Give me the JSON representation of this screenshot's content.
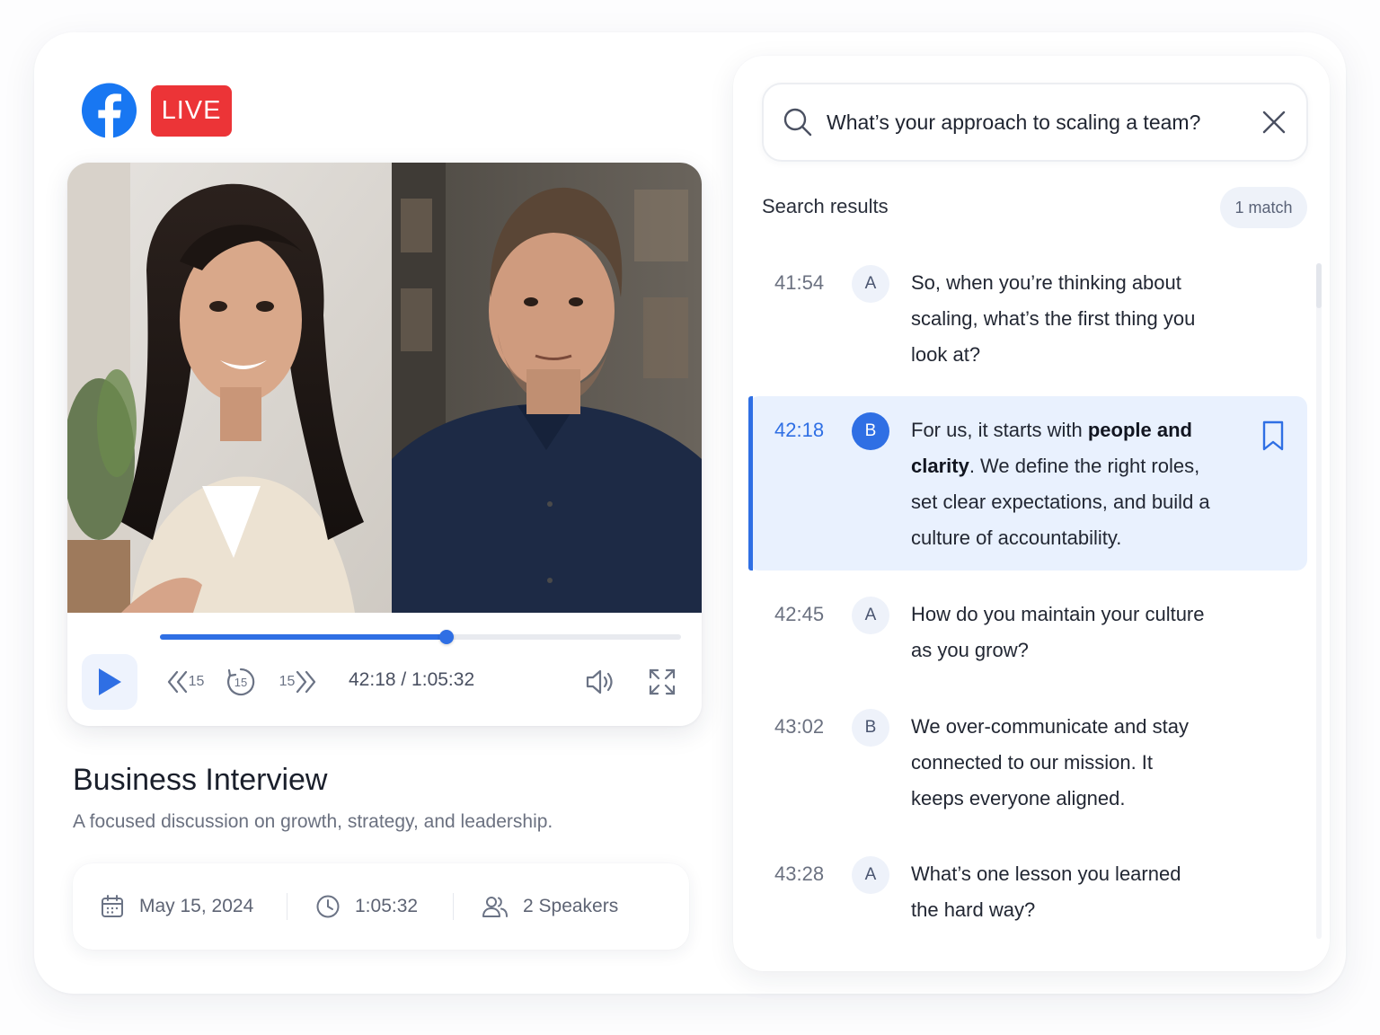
{
  "brand": {
    "logo_icon": "facebook-icon",
    "live_label": "LIVE",
    "brand_color": "#1877f2",
    "live_color": "#ec3437"
  },
  "player": {
    "progress_fraction": 0.55,
    "time_readout": "42:18 / 1:05:32",
    "rewind_label": "15",
    "replay_label": "15",
    "forward_label": "15",
    "accent": "#2f6fe4"
  },
  "episode": {
    "title": "Business Interview",
    "subtitle": "A focused discussion on growth, strategy, and leadership.",
    "date": "May 15, 2024",
    "duration": "1:05:32",
    "speakers": "2 Speakers"
  },
  "search": {
    "query": "What’s your approach to scaling a team?",
    "heading": "Search results",
    "match_count": "1 match"
  },
  "results": [
    {
      "time": "41:54",
      "speaker": "A",
      "text": "So, when you’re thinking about scaling, what’s the first thing you look at?"
    },
    {
      "time": "42:18",
      "speaker": "B",
      "text_before": "For us, it starts with ",
      "text_bold_1": "people and clarity",
      "text_after": ". We define the right roles, set clear expectations, and build a culture of accountability."
    },
    {
      "time": "42:45",
      "speaker": "A",
      "text": "How do you maintain your culture as you grow?"
    },
    {
      "time": "43:02",
      "speaker": "B",
      "text": "We over-communicate and stay connected to our mission. It keeps everyone aligned."
    },
    {
      "time": "43:28",
      "speaker": "A",
      "text": "What’s one lesson you learned the hard way?"
    }
  ]
}
